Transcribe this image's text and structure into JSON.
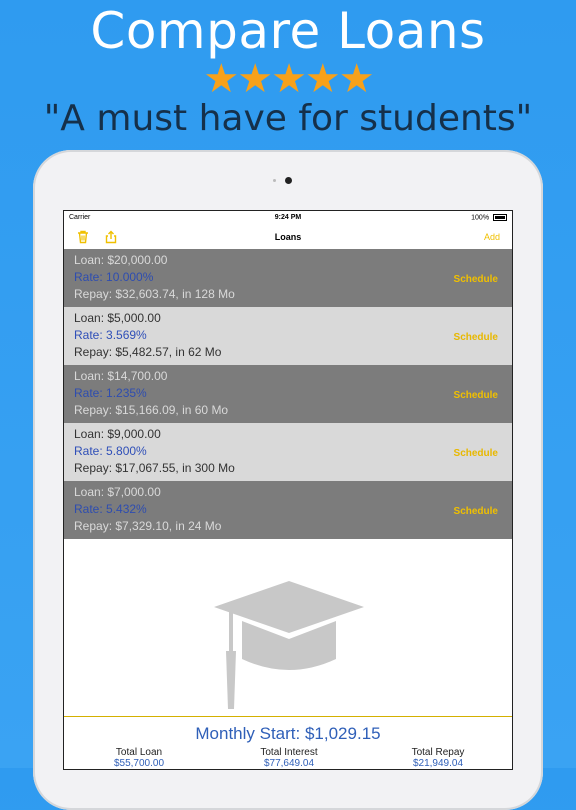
{
  "promo": {
    "headline": "Compare Loans",
    "stars": "★★★★★",
    "quote": "\"A must have for students\""
  },
  "status_bar": {
    "carrier": "Carrier",
    "time": "9:24 PM",
    "battery": "100%"
  },
  "nav": {
    "title": "Loans",
    "add_label": "Add"
  },
  "loans": [
    {
      "loan": "Loan: $20,000.00",
      "rate": "Rate: 10.000%",
      "repay": "Repay: $32,603.74, in 128 Mo",
      "schedule_label": "Schedule"
    },
    {
      "loan": "Loan: $5,000.00",
      "rate": "Rate: 3.569%",
      "repay": "Repay: $5,482.57, in 62 Mo",
      "schedule_label": "Schedule"
    },
    {
      "loan": "Loan: $14,700.00",
      "rate": "Rate: 1.235%",
      "repay": "Repay: $15,166.09, in 60 Mo",
      "schedule_label": "Schedule"
    },
    {
      "loan": "Loan: $9,000.00",
      "rate": "Rate: 5.800%",
      "repay": "Repay: $17,067.55, in 300 Mo",
      "schedule_label": "Schedule"
    },
    {
      "loan": "Loan: $7,000.00",
      "rate": "Rate: 5.432%",
      "repay": "Repay: $7,329.10, in 24 Mo",
      "schedule_label": "Schedule"
    }
  ],
  "summary": {
    "monthly_start": "Monthly Start: $1,029.15",
    "total_loan_label": "Total Loan",
    "total_loan_value": "$55,700.00",
    "total_interest_label": "Total Interest",
    "total_interest_value": "$77,649.04",
    "total_repay_label": "Total Repay",
    "total_repay_value": "$21,949.04"
  },
  "colors": {
    "accent_yellow": "#f0c000",
    "rate_blue": "#2f4fb8",
    "background_blue": "#2f9bf0",
    "star_orange": "#f7a11a"
  }
}
